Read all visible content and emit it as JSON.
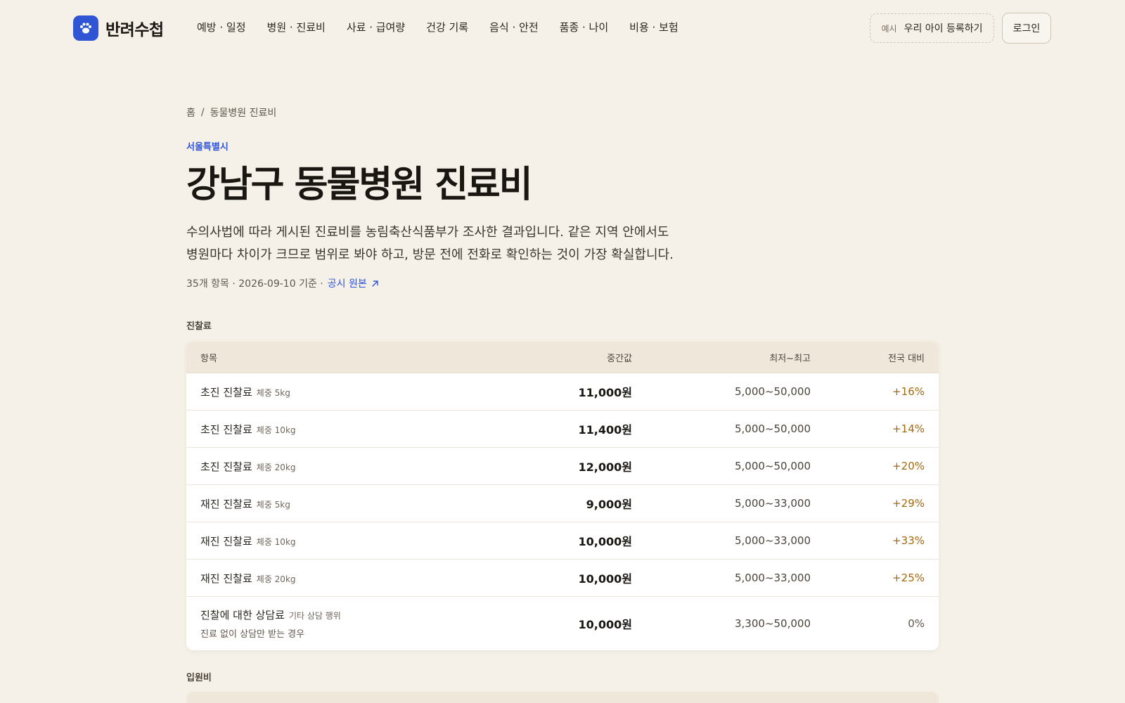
{
  "brand": {
    "name": "반려수첩",
    "accent": "#2f55d4"
  },
  "nav": {
    "items": [
      "예방 · 일정",
      "병원 · 진료비",
      "사료 · 급여량",
      "건강 기록",
      "음식 · 안전",
      "품종 · 나이",
      "비용 · 보험"
    ]
  },
  "header": {
    "example_tag": "예시",
    "example_label": "우리 아이 등록하기",
    "login_label": "로그인"
  },
  "breadcrumb": {
    "home": "홈",
    "separator": "/",
    "current": "동물병원 진료비"
  },
  "region": "서울특별시",
  "title": "강남구 동물병원 진료비",
  "description": "수의사법에 따라 게시된 진료비를 농림축산식품부가 조사한 결과입니다. 같은 지역 안에서도 병원마다 차이가 크므로 범위로 봐야 하고, 방문 전에 전화로 확인하는 것이 가장 확실합니다.",
  "meta": {
    "summary": "35개 항목 · 2026-09-10 기준 ·",
    "source_link": "공시 원본",
    "source_icon": "arrow-up-right-icon"
  },
  "sections": [
    {
      "title": "진찰료",
      "columns": {
        "item": "항목",
        "median": "중간값",
        "range": "최저~최고",
        "diff": "전국 대비"
      },
      "rows": [
        {
          "name": "초진 진찰료",
          "sub": "체중 5kg",
          "note": "",
          "median": "11,000원",
          "range": "5,000~50,000",
          "diff": "+16%"
        },
        {
          "name": "초진 진찰료",
          "sub": "체중 10kg",
          "note": "",
          "median": "11,400원",
          "range": "5,000~50,000",
          "diff": "+14%"
        },
        {
          "name": "초진 진찰료",
          "sub": "체중 20kg",
          "note": "",
          "median": "12,000원",
          "range": "5,000~50,000",
          "diff": "+20%"
        },
        {
          "name": "재진 진찰료",
          "sub": "체중 5kg",
          "note": "",
          "median": "9,000원",
          "range": "5,000~33,000",
          "diff": "+29%"
        },
        {
          "name": "재진 진찰료",
          "sub": "체중 10kg",
          "note": "",
          "median": "10,000원",
          "range": "5,000~33,000",
          "diff": "+33%"
        },
        {
          "name": "재진 진찰료",
          "sub": "체중 20kg",
          "note": "",
          "median": "10,000원",
          "range": "5,000~33,000",
          "diff": "+25%"
        },
        {
          "name": "진찰에 대한 상담료",
          "sub": "기타 상담 행위",
          "note": "진료 없이 상담만 받는 경우",
          "median": "10,000원",
          "range": "3,300~50,000",
          "diff": "0%"
        }
      ]
    },
    {
      "title": "입원비"
    }
  ],
  "colors": {
    "background": "#f5f1e8",
    "diff_up": "#a2690d",
    "table_header": "#efe8da"
  }
}
